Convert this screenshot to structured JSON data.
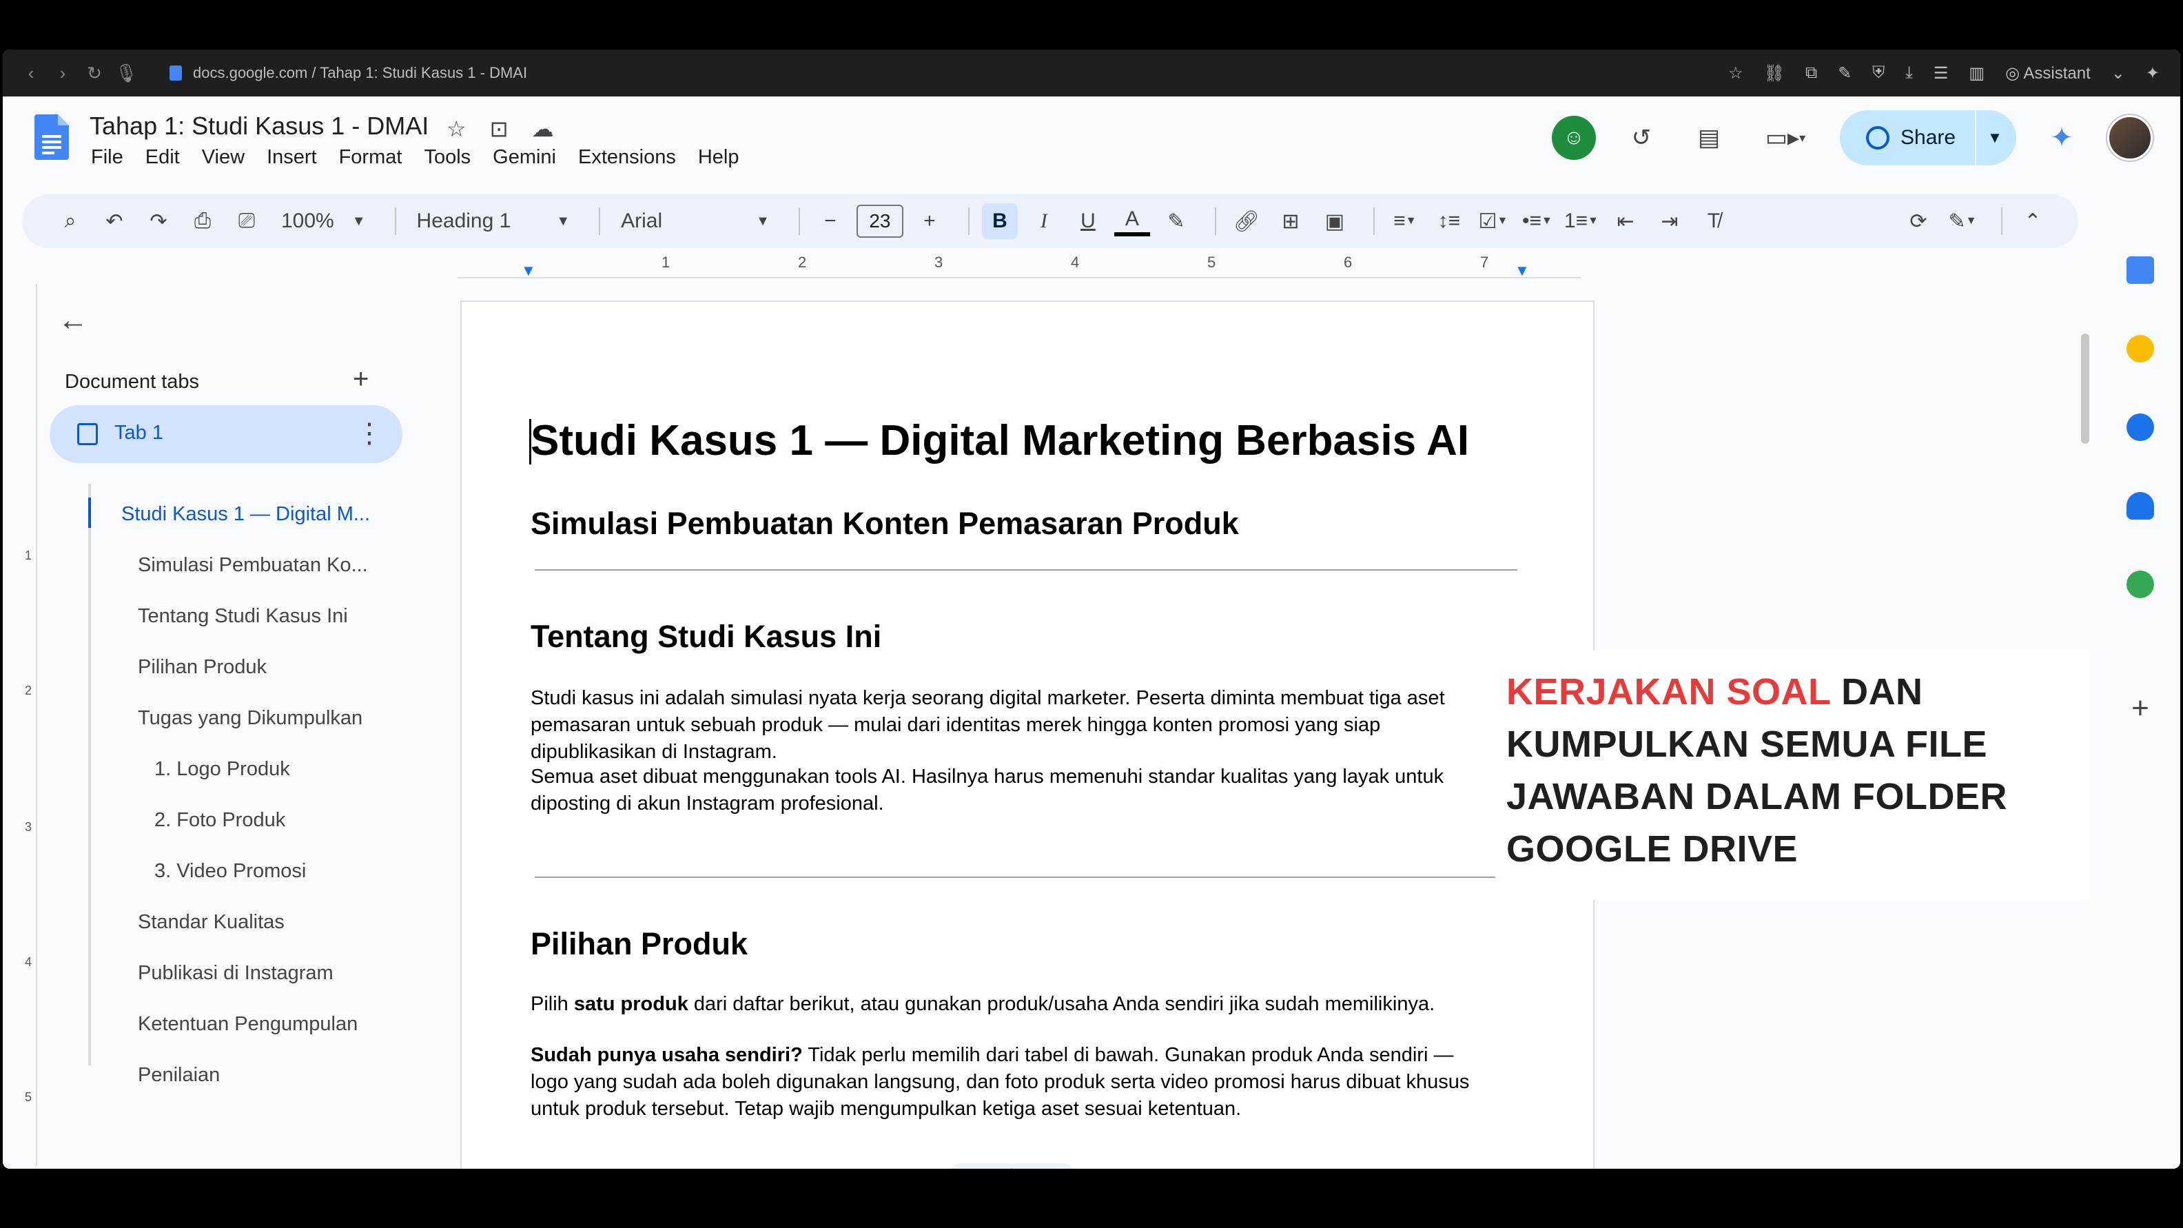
{
  "browser": {
    "url": "docs.google.com / Tahap 1: Studi Kasus 1 - DMAI",
    "assistant_label": "Assistant"
  },
  "doc": {
    "title": "Tahap 1: Studi Kasus 1 - DMAI",
    "menu": [
      "File",
      "Edit",
      "View",
      "Insert",
      "Format",
      "Tools",
      "Gemini",
      "Extensions",
      "Help"
    ],
    "share_label": "Share"
  },
  "toolbar": {
    "zoom": "100%",
    "style": "Heading 1",
    "font": "Arial",
    "font_size": "23",
    "bold": "B",
    "italic": "I",
    "underline": "U",
    "text_color": "A"
  },
  "ruler": [
    "1",
    "2",
    "3",
    "4",
    "5",
    "6",
    "7"
  ],
  "vruler": [
    "1",
    "2",
    "3",
    "4",
    "5"
  ],
  "sidebar": {
    "heading": "Document tabs",
    "tab_label": "Tab 1",
    "outline": [
      "Studi Kasus 1 — Digital M...",
      "Simulasi Pembuatan Ko...",
      "Tentang Studi Kasus Ini",
      "Pilihan Produk",
      "Tugas yang Dikumpulkan",
      "1. Logo Produk",
      "2. Foto Produk",
      "3. Video Promosi",
      "Standar Kualitas",
      "Publikasi di Instagram",
      "Ketentuan Pengumpulan",
      "Penilaian"
    ]
  },
  "content": {
    "h1": "Studi Kasus 1 — Digital Marketing Berbasis AI",
    "subtitle": "Simulasi Pembuatan Konten Pemasaran Produk",
    "section1_title": "Tentang Studi Kasus Ini",
    "section1_p1_l1": "Studi kasus ini adalah simulasi nyata kerja seorang digital marketer. Peserta diminta membuat tiga aset",
    "section1_p1_l2": "pemasaran untuk sebuah produk — mulai dari identitas merek hingga konten promosi yang siap",
    "section1_p1_l3": "dipublikasikan di Instagram.",
    "section1_p2_l1": "Semua aset dibuat menggunakan tools AI. Hasilnya harus memenuhi standar kualitas yang layak untuk",
    "section1_p2_l2": "diposting di akun Instagram profesional.",
    "section2_title": "Pilihan Produk",
    "section2_p1_a": "Pilih ",
    "section2_p1_b": "satu produk",
    "section2_p1_c": " dari daftar berikut, atau gunakan produk/usaha Anda sendiri jika sudah memilikinya.",
    "section2_p2_bold": "Sudah punya usaha sendiri?",
    "section2_p2_l1": " Tidak perlu memilih dari tabel di bawah. Gunakan produk Anda sendiri —",
    "section2_p2_l2": "logo yang sudah ada boleh digunakan langsung, dan foto produk serta video promosi harus dibuat khusus",
    "section2_p2_l3": "untuk produk tersebut. Tetap wajib mengumpulkan ketiga aset sesuai ketentuan."
  },
  "overlay": {
    "red": "KERJAKAN SOAL",
    "line1_rest": " DAN",
    "line2": "KUMPULKAN SEMUA FILE",
    "line3": "JAWABAN DALAM FOLDER",
    "line4": "GOOGLE DRIVE",
    "red_color": "#e63b3b"
  }
}
